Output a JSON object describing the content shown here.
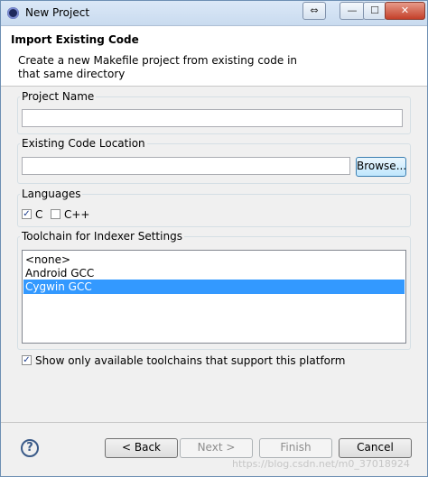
{
  "window": {
    "title": "New Project",
    "controls": {
      "restore": "⇔",
      "minimize": "—",
      "maximize": "☐",
      "close": "✕"
    }
  },
  "header": {
    "title": "Import Existing Code",
    "description": "Create a new Makefile project from existing code in that same directory"
  },
  "project_name": {
    "label": "Project Name",
    "value": ""
  },
  "code_location": {
    "label": "Existing Code Location",
    "value": "",
    "browse_label": "Browse..."
  },
  "languages": {
    "label": "Languages",
    "options": [
      {
        "label": "C",
        "checked": true
      },
      {
        "label": "C++",
        "checked": false
      }
    ]
  },
  "toolchain": {
    "label": "Toolchain for Indexer Settings",
    "items": [
      "<none>",
      "Android GCC",
      "Cygwin GCC"
    ],
    "selected": "Cygwin GCC",
    "show_only_label": "Show only available toolchains that support this platform",
    "show_only_checked": true
  },
  "footer": {
    "back_label": "< Back",
    "next_label": "Next >",
    "finish_label": "Finish",
    "cancel_label": "Cancel",
    "help_icon": "?"
  },
  "watermark": "https://blog.csdn.net/m0_37018924"
}
